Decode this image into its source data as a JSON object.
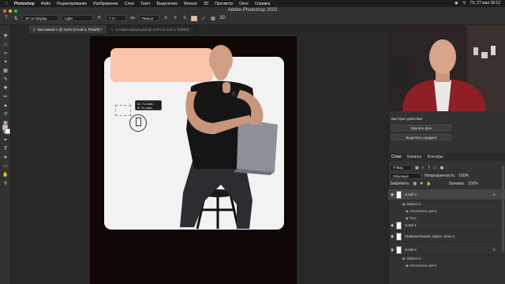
{
  "menubar": {
    "items": [
      "Photoshop",
      "Файл",
      "Редактирование",
      "Изображение",
      "Слои",
      "Текст",
      "Выделение",
      "Фильтр",
      "3D",
      "Просмотр",
      "Окно",
      "Справка"
    ],
    "clock": "Пт, 27 мая 18:12"
  },
  "window": {
    "title": "Adobe Photoshop 2020"
  },
  "options": {
    "font_family": "SF UI Display",
    "font_style": "Light",
    "font_size": "7 пт",
    "antialias": "Резкое",
    "color_swatch": "#f7b89a"
  },
  "tabs": [
    {
      "label": "Без имени-1 @ 114% (Слой 3, RGB/8) *",
      "active": true
    },
    {
      "label": "готовая версия.psd @ 119% (Слой 3, RGB/8) *",
      "active": false
    }
  ],
  "canvas": {
    "hud_line1": "Ш: 71 пикс.",
    "hud_line2": "В: 31 пикс.",
    "doc_bg": "#0f0606",
    "card_bg": "#f2f2f2",
    "accent_rect": "#fcc5ab"
  },
  "quick_actions": {
    "header": "Быстрые действия",
    "btn_remove_bg": "Удалить фон",
    "btn_select_subject": "Выделить предмет"
  },
  "layers_panel": {
    "tabs": [
      "Слои",
      "Каналы",
      "Контуры"
    ],
    "filter_label": "Вид",
    "blend_mode": "Обычные",
    "opacity_label": "Непрозрачность:",
    "opacity_value": "100%",
    "lock_label": "Закрепить:",
    "fill_label": "Заливка:",
    "fill_value": "100%",
    "layers": [
      {
        "name": "Слой 3",
        "fx": "fx",
        "selected": true
      },
      {
        "sub": "Эффекты"
      },
      {
        "sub": "Наложение цвета"
      },
      {
        "sub": "Тень"
      },
      {
        "name": "Слой 1",
        "fx": "",
        "selected": false
      },
      {
        "name": "Прямоугольник, скругл. углы 1",
        "fx": "",
        "selected": false
      },
      {
        "name": "Слой 2",
        "fx": "fx",
        "selected": false
      },
      {
        "sub": "Эффекты"
      },
      {
        "sub": "Наложение цвета"
      }
    ]
  }
}
